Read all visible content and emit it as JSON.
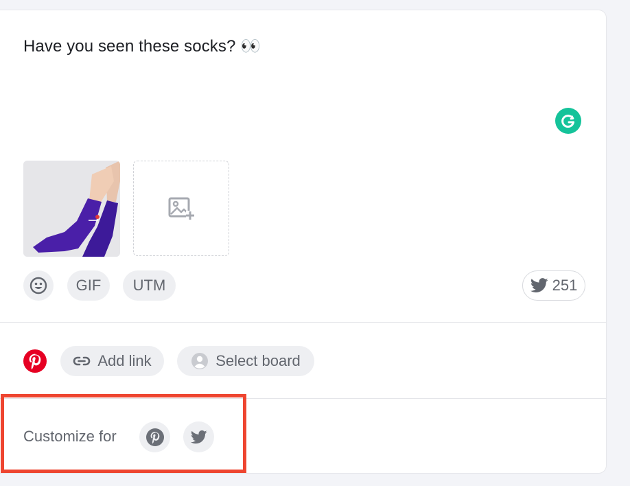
{
  "composer": {
    "text": "Have you seen these socks? 👀",
    "grammarly_icon": "grammarly-icon",
    "media": {
      "thumbnail_alt": "purple socks",
      "add_media_icon": "image-add-icon"
    },
    "toolbar": {
      "emoji_icon": "emoji-icon",
      "gif_label": "GIF",
      "utm_label": "UTM",
      "char_count": "251",
      "char_count_icon": "twitter-icon"
    }
  },
  "pinterest_options": {
    "network_icon": "pinterest-icon",
    "add_link_label": "Add link",
    "select_board_label": "Select board"
  },
  "customize": {
    "label": "Customize for",
    "networks": [
      "pinterest",
      "twitter"
    ]
  },
  "colors": {
    "pinterest": "#e60023",
    "grammarly": "#15c39a",
    "highlight": "#ee4530",
    "sock": "#4a1fa8"
  }
}
